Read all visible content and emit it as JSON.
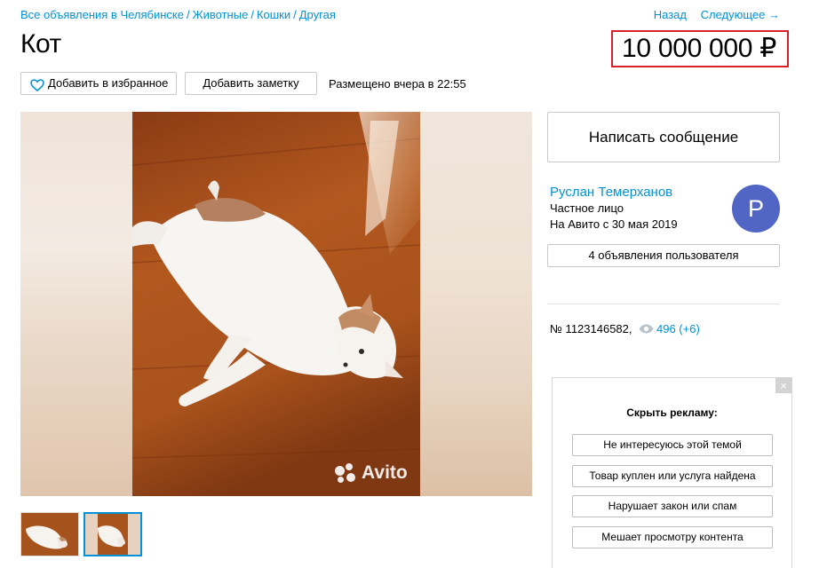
{
  "breadcrumbs": [
    "Все объявления в Челябинске",
    "Животные",
    "Кошки",
    "Другая"
  ],
  "nav": {
    "back": "Назад",
    "next": "Следующее →"
  },
  "listing": {
    "title": "Кот",
    "price": "10 000 000 ₽",
    "favorite_label": "Добавить в избранное",
    "note_label": "Добавить заметку",
    "posted": "Размещено вчера в 22:55",
    "watermark": "Avito",
    "number": "№ 1123146582,",
    "views": "496 (+6)"
  },
  "seller": {
    "write_button": "Написать сообщение",
    "name": "Руслан Темерханов",
    "type": "Частное лицо",
    "since": "На Авито с 30 мая 2019",
    "avatar_letter": "Р",
    "avatar_color": "#5166c4",
    "ads_button": "4 объявления пользователя"
  },
  "ad_hide": {
    "close": "×",
    "title": "Скрыть рекламу:",
    "options": [
      "Не интересуюсь этой темой",
      "Товар куплен или услуга найдена",
      "Нарушает закон или спам",
      "Мешает просмотру контента"
    ]
  },
  "colors": {
    "link": "#0091d9",
    "price_highlight": "#d8202a"
  },
  "icons": [
    "heart-icon",
    "eye-icon",
    "avito-logo-icon",
    "close-icon"
  ]
}
